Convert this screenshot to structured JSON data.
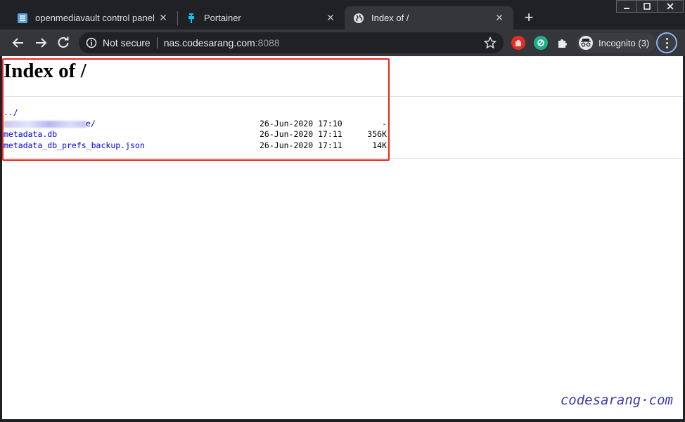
{
  "tabs": [
    {
      "title": "openmediavault control panel - I",
      "icon": "omv-icon"
    },
    {
      "title": "Portainer",
      "icon": "portainer-icon"
    },
    {
      "title": "Index of /",
      "icon": "globe-icon",
      "active": true
    }
  ],
  "new_tab_label": "+",
  "omnibox": {
    "security_label": "Not secure",
    "host": "nas.codesarang.com",
    "port": ":8088"
  },
  "profile": {
    "label": "Incognito (3)"
  },
  "page": {
    "heading": "Index of /",
    "entries": [
      {
        "name": "../",
        "date": "",
        "size": ""
      },
      {
        "name": "e/",
        "date": "26-Jun-2020 17:10",
        "size": "-",
        "redacted": true
      },
      {
        "name": "metadata.db",
        "date": "26-Jun-2020 17:11",
        "size": "356K"
      },
      {
        "name": "metadata_db_prefs_backup.json",
        "date": "26-Jun-2020 17:11",
        "size": "14K"
      }
    ]
  },
  "watermark": "codesarang·com",
  "colors": {
    "link": "#0000ee",
    "highlight_border": "#ee2222",
    "chrome_dark": "#202124",
    "toolbar": "#35363a"
  }
}
